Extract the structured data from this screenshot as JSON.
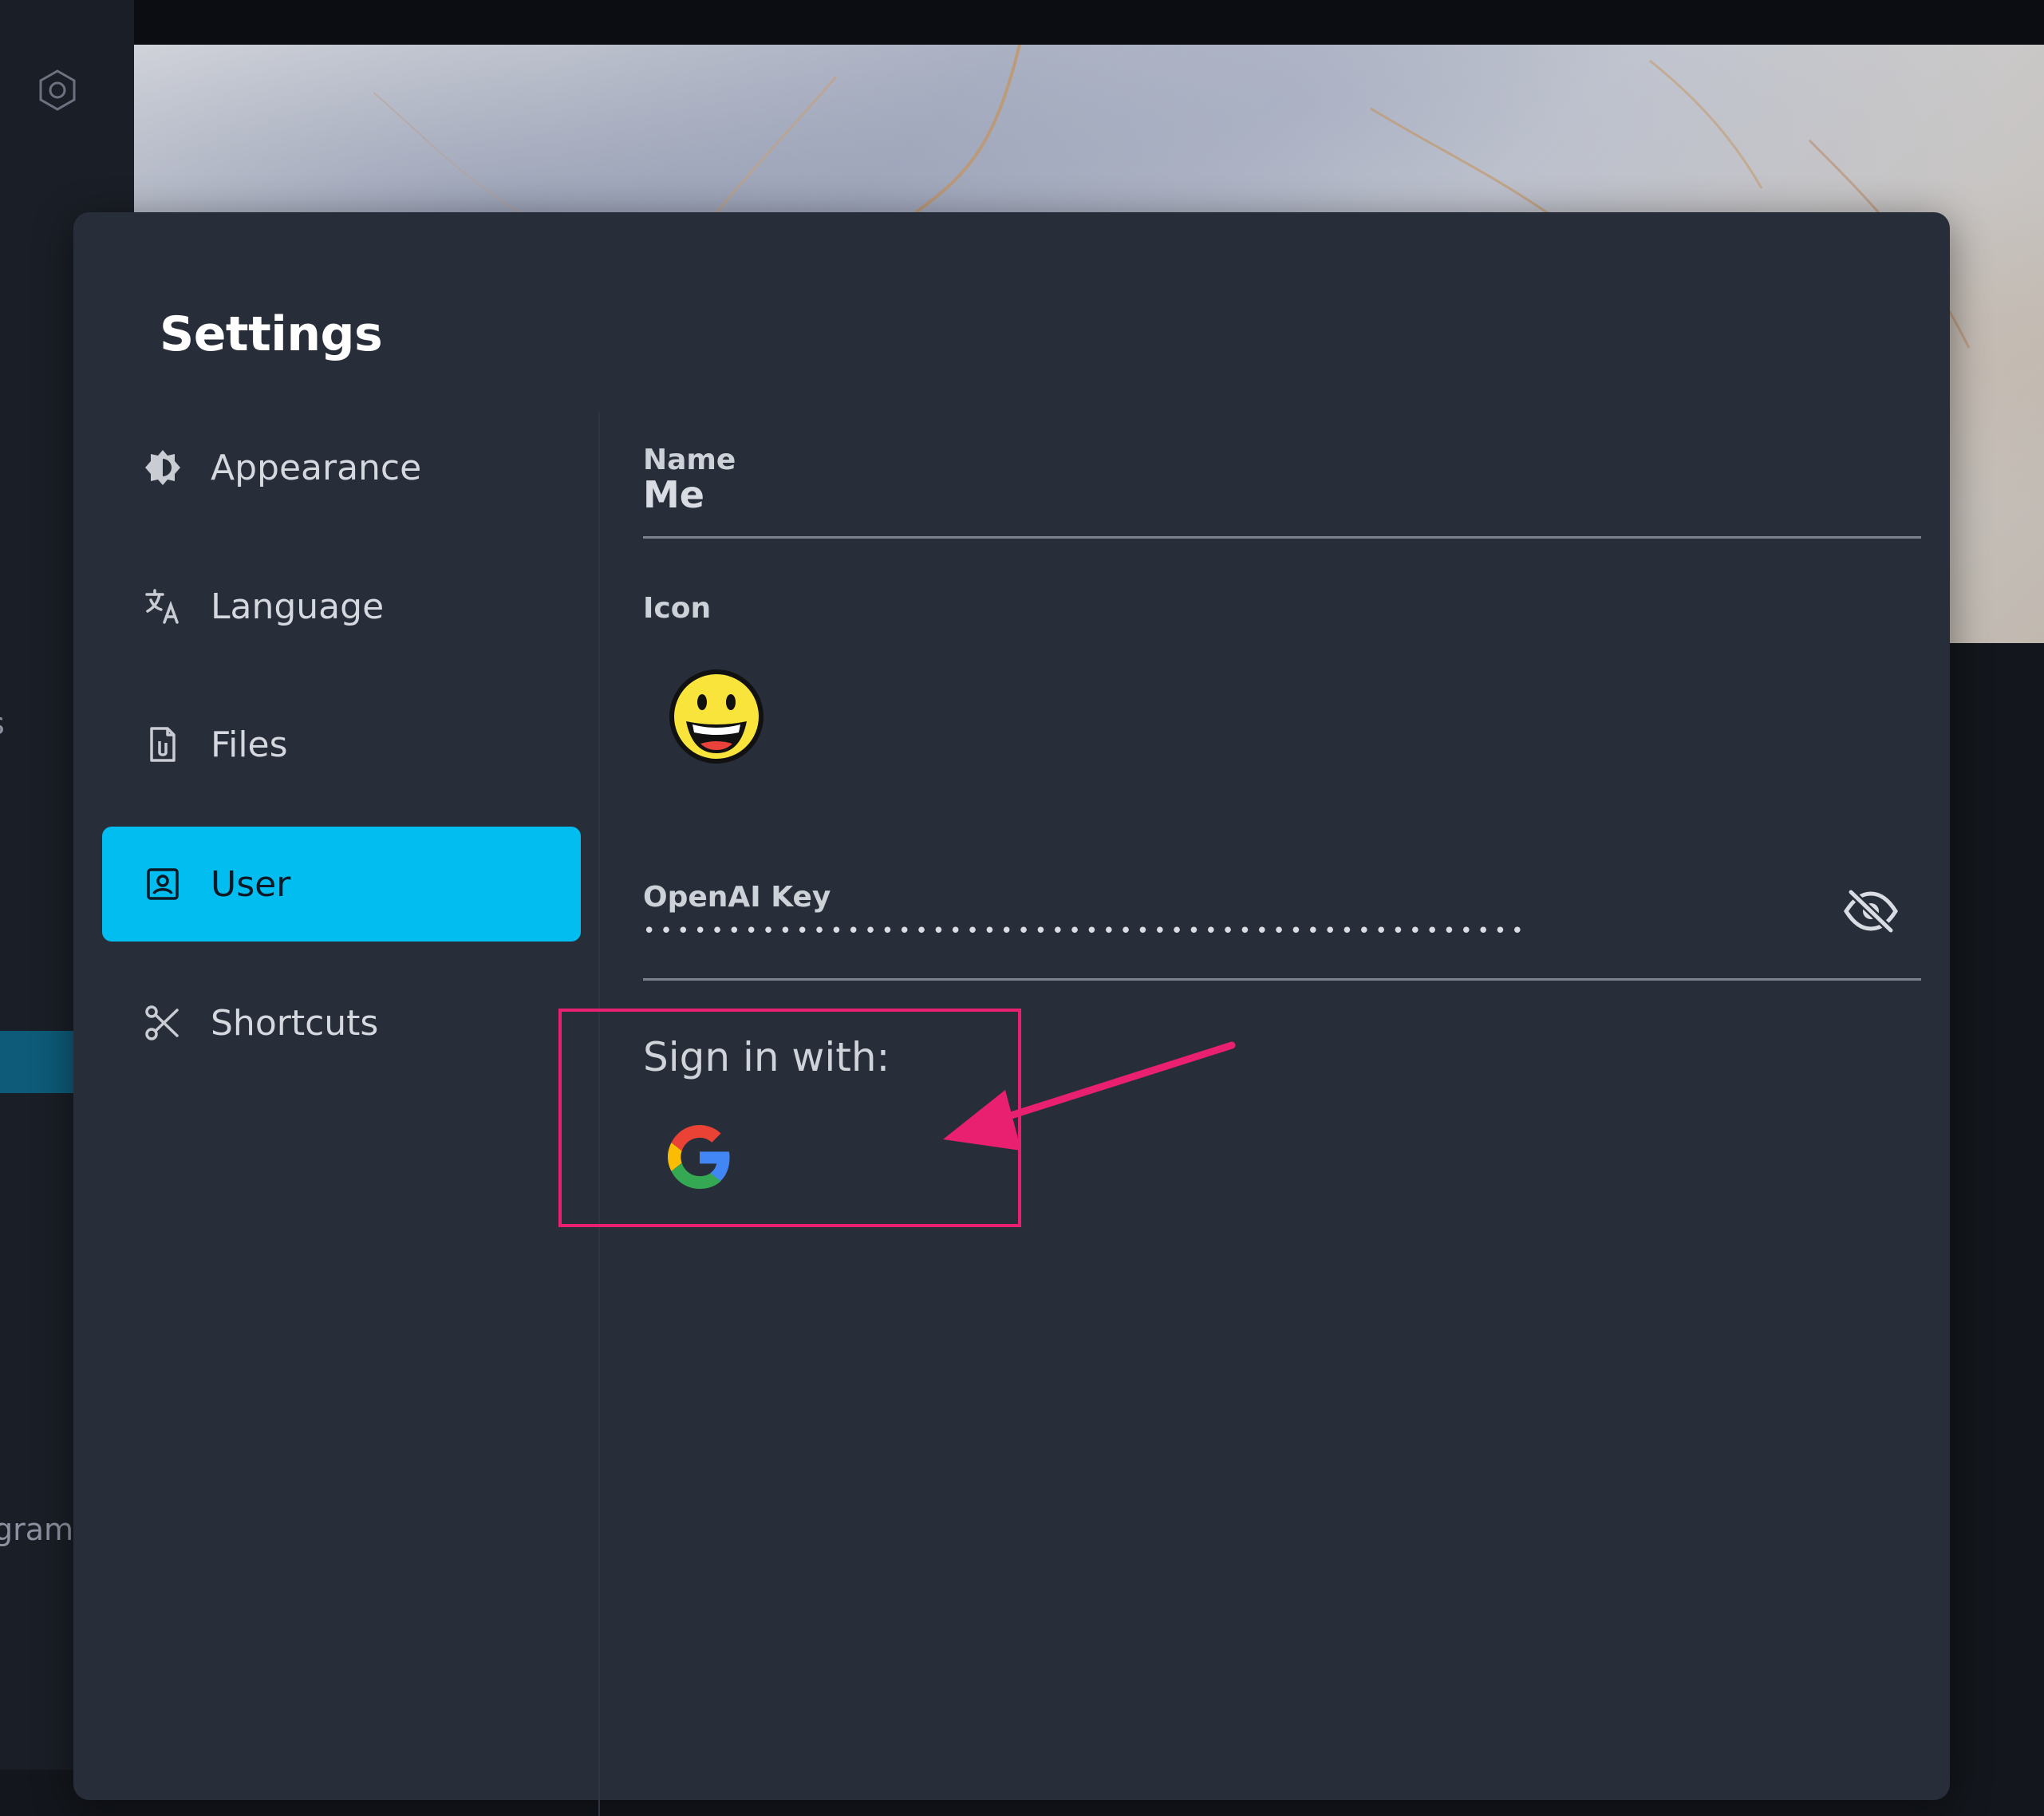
{
  "settings": {
    "title": "Settings",
    "nav": [
      {
        "label": "Appearance",
        "icon": "appearance-icon"
      },
      {
        "label": "Language",
        "icon": "translate-icon"
      },
      {
        "label": "Files",
        "icon": "file-icon"
      },
      {
        "label": "User",
        "icon": "user-badge-icon",
        "active": true
      },
      {
        "label": "Shortcuts",
        "icon": "scissors-icon"
      }
    ],
    "user": {
      "name_label": "Name",
      "name_value": "Me",
      "icon_label": "Icon",
      "icon_emoji": "grinning-face-emoji",
      "openai_key_label": "OpenAI Key",
      "openai_key_value": "••••••••••••••••••••••••••••••••••••••••••••••••••••",
      "key_visibility_icon": "eye-off-icon",
      "signin_label": "Sign in with:",
      "signin_provider_icon": "google-icon"
    }
  },
  "background": {
    "sidebar_snippet_1": "s",
    "sidebar_snippet_2": "gram",
    "app_logo": "hexagon-logo-icon"
  },
  "colors": {
    "dialog_bg": "#282d3a",
    "active_nav_bg": "#02bdf0",
    "annotation": "#e8206f"
  }
}
